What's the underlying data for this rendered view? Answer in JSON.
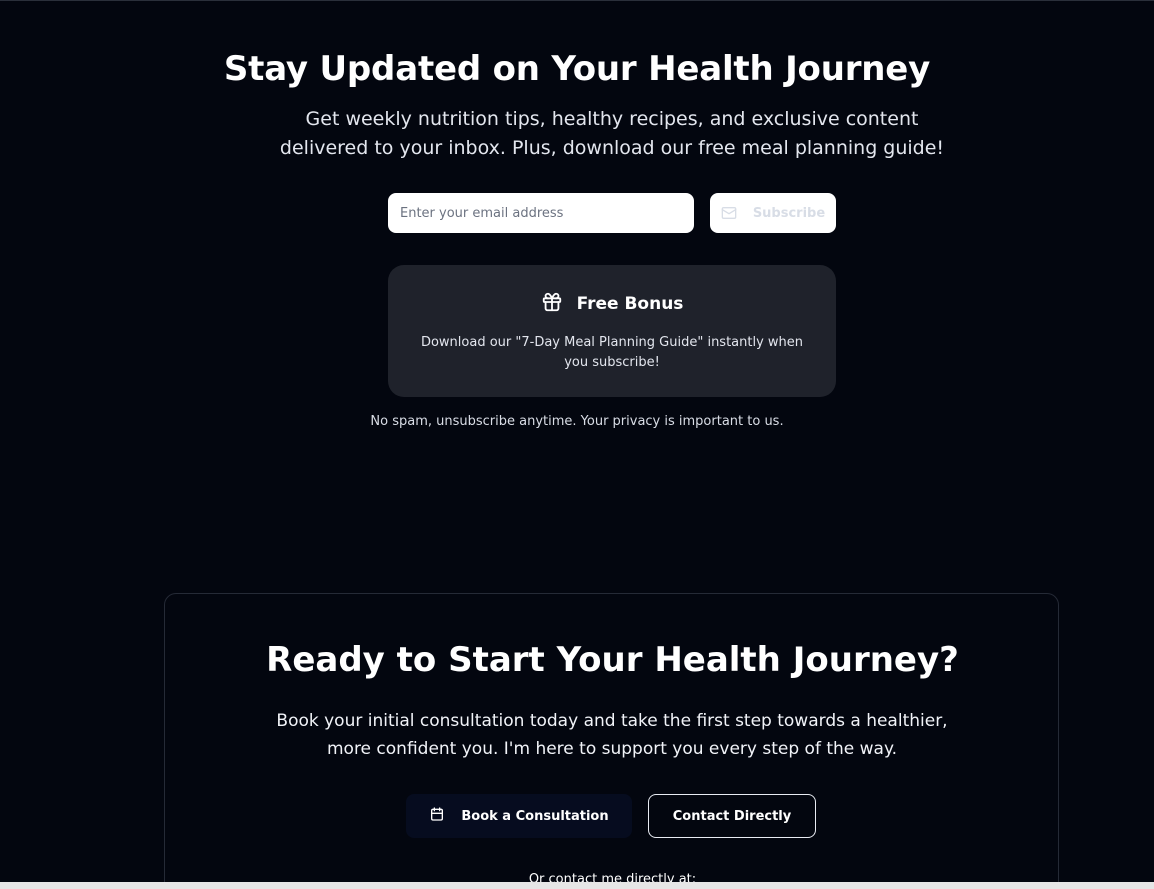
{
  "newsletter": {
    "title": "Stay Updated on Your Health Journey",
    "subtitle": "Get weekly nutrition tips, healthy recipes, and exclusive content delivered to your inbox. Plus, download our free meal planning guide!",
    "email_placeholder": "Enter your email address",
    "email_value": "",
    "subscribe_label": "Subscribe",
    "subscribe_icon": "mail-icon",
    "bonus": {
      "icon": "gift-icon",
      "title": "Free Bonus",
      "text": "Download our \"7-Day Meal Planning Guide\" instantly when you subscribe!"
    },
    "privacy_note": "No spam, unsubscribe anytime. Your privacy is important to us."
  },
  "cta": {
    "title": "Ready to Start Your Health Journey?",
    "subtitle": "Book your initial consultation today and take the first step towards a healthier, more confident you. I'm here to support you every step of the way.",
    "book_label": "Book a Consultation",
    "book_icon": "calendar-icon",
    "contact_label": "Contact Directly",
    "or_contact": "Or contact me directly at:"
  },
  "colors": {
    "background": "#03060f",
    "card": "#1f222b",
    "text": "#ffffff",
    "muted_text": "#e3e6ee"
  }
}
